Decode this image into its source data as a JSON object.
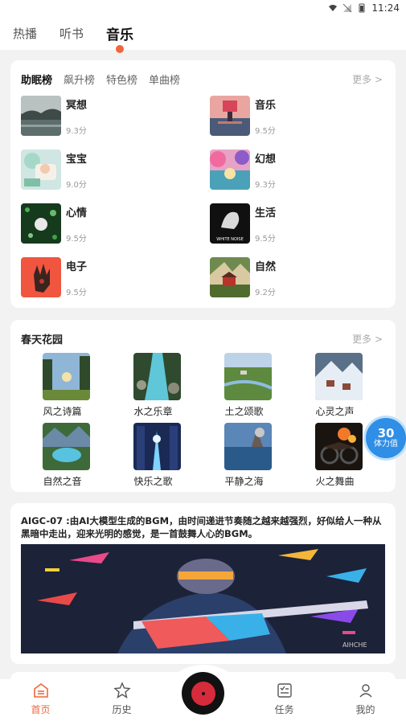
{
  "status_bar": {
    "time": "11:24"
  },
  "top_tabs": [
    {
      "label": "热播"
    },
    {
      "label": "听书"
    },
    {
      "label": "音乐"
    }
  ],
  "ranking": {
    "tabs": [
      {
        "label": "助眠榜"
      },
      {
        "label": "飙升榜"
      },
      {
        "label": "特色榜"
      },
      {
        "label": "单曲榜"
      }
    ],
    "more": "更多 >",
    "items": [
      {
        "title": "冥想",
        "score": "9.3分"
      },
      {
        "title": "音乐",
        "score": "9.5分"
      },
      {
        "title": "宝宝",
        "score": "9.0分"
      },
      {
        "title": "幻想",
        "score": "9.3分"
      },
      {
        "title": "心情",
        "score": "9.5分"
      },
      {
        "title": "生活",
        "score": "9.5分"
      },
      {
        "title": "电子",
        "score": "9.5分"
      },
      {
        "title": "自然",
        "score": "9.2分"
      }
    ],
    "thumb_caption": "WHITE NOISE"
  },
  "garden": {
    "title": "春天花园",
    "more": "更多 >",
    "items": [
      {
        "name": "风之诗篇"
      },
      {
        "name": "水之乐章"
      },
      {
        "name": "土之颂歌"
      },
      {
        "name": "心灵之声"
      },
      {
        "name": "自然之音"
      },
      {
        "name": "快乐之歌"
      },
      {
        "name": "平静之海"
      },
      {
        "name": "火之舞曲"
      }
    ]
  },
  "badge": {
    "value": "30",
    "label": "体力值"
  },
  "aigc": {
    "text": "AIGC-07 :由AI大模型生成的BGM，由时间递进节奏随之越来越强烈，好似给人一种从黑暗中走出，迎来光明的感觉，是一首鼓舞人心的BGM。",
    "image_caption": "AIHCHE"
  },
  "bottom_nav": [
    {
      "label": "首页",
      "icon": "home-icon"
    },
    {
      "label": "历史",
      "icon": "star-icon"
    },
    {
      "label": "任务",
      "icon": "task-icon"
    },
    {
      "label": "我的",
      "icon": "user-icon"
    }
  ],
  "colors": {
    "accent": "#f0663d",
    "badge": "#2f8ee6"
  }
}
